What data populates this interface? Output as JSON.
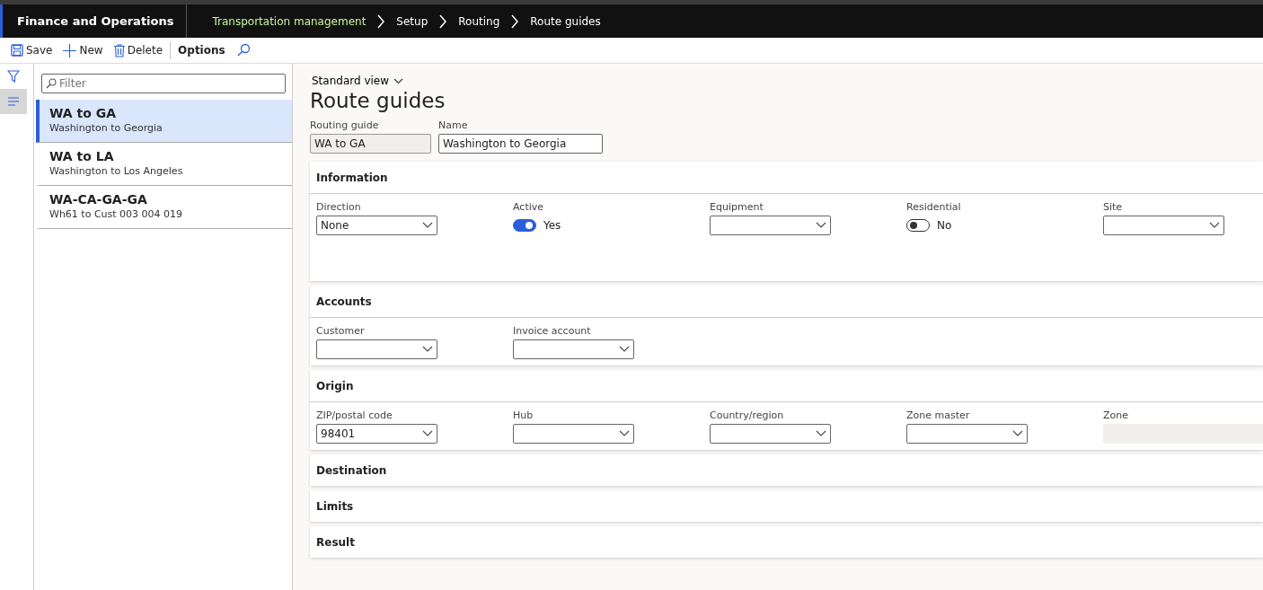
{
  "app": {
    "title": "Finance and Operations"
  },
  "breadcrumb": [
    {
      "label": "Transportation management"
    },
    {
      "label": "Setup"
    },
    {
      "label": "Routing"
    },
    {
      "label": "Route guides"
    }
  ],
  "toolbar": [
    {
      "label": "Save",
      "kind": "save"
    },
    {
      "label": "New",
      "kind": "new"
    },
    {
      "label": "Delete",
      "kind": "delete"
    },
    {
      "label": "Options",
      "kind": "plain"
    },
    {
      "kind": "search"
    }
  ],
  "filter": {
    "placeholder": "Filter"
  },
  "list": [
    {
      "title": "WA to GA",
      "subtitle": "Washington to Georgia",
      "selected": true
    },
    {
      "title": "WA to LA",
      "subtitle": "Washington to Los Angeles",
      "selected": false
    },
    {
      "title": "WA-CA-GA-GA",
      "subtitle": "Wh61 to Cust 003 004 019",
      "selected": false
    }
  ],
  "view": "Standard view",
  "page_title": "Route guides",
  "header_fields": [
    {
      "label": "Routing guide",
      "value": "WA to GA",
      "kind": "readonly"
    },
    {
      "label": "Name",
      "value": "Washington to Georgia",
      "kind": "text"
    }
  ],
  "sections": [
    {
      "title": "Information",
      "fields": [
        {
          "label": "Direction",
          "kind": "combo",
          "value": "None"
        },
        {
          "label": "Active",
          "kind": "toggle",
          "on": true,
          "value": "Yes"
        },
        {
          "label": "Equipment",
          "kind": "combo"
        },
        {
          "label": "Residential",
          "kind": "toggle",
          "on": false,
          "value": "No"
        },
        {
          "label": "Site",
          "kind": "combo"
        }
      ]
    },
    {
      "title": "Accounts",
      "fields": [
        {
          "label": "Customer",
          "kind": "combo"
        },
        {
          "label": "Invoice account",
          "kind": "combo"
        }
      ]
    },
    {
      "title": "Origin",
      "fields": [
        {
          "label": "ZIP/postal code",
          "kind": "combo",
          "value": "98401"
        },
        {
          "label": "Hub",
          "kind": "combo"
        },
        {
          "label": "Country/region",
          "kind": "combo"
        },
        {
          "label": "Zone master",
          "kind": "combo"
        },
        {
          "label": "Zone",
          "kind": "readonly"
        }
      ]
    },
    {
      "title": "Destination"
    },
    {
      "title": "Limits"
    },
    {
      "title": "Result"
    }
  ]
}
